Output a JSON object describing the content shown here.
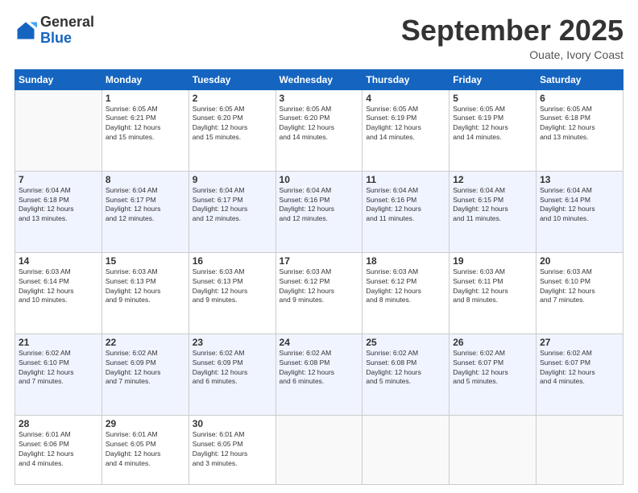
{
  "header": {
    "logo_general": "General",
    "logo_blue": "Blue",
    "month_title": "September 2025",
    "subtitle": "Ouate, Ivory Coast"
  },
  "weekdays": [
    "Sunday",
    "Monday",
    "Tuesday",
    "Wednesday",
    "Thursday",
    "Friday",
    "Saturday"
  ],
  "weeks": [
    [
      {
        "day": "",
        "info": ""
      },
      {
        "day": "1",
        "info": "Sunrise: 6:05 AM\nSunset: 6:21 PM\nDaylight: 12 hours\nand 15 minutes."
      },
      {
        "day": "2",
        "info": "Sunrise: 6:05 AM\nSunset: 6:20 PM\nDaylight: 12 hours\nand 15 minutes."
      },
      {
        "day": "3",
        "info": "Sunrise: 6:05 AM\nSunset: 6:20 PM\nDaylight: 12 hours\nand 14 minutes."
      },
      {
        "day": "4",
        "info": "Sunrise: 6:05 AM\nSunset: 6:19 PM\nDaylight: 12 hours\nand 14 minutes."
      },
      {
        "day": "5",
        "info": "Sunrise: 6:05 AM\nSunset: 6:19 PM\nDaylight: 12 hours\nand 14 minutes."
      },
      {
        "day": "6",
        "info": "Sunrise: 6:05 AM\nSunset: 6:18 PM\nDaylight: 12 hours\nand 13 minutes."
      }
    ],
    [
      {
        "day": "7",
        "info": "Sunrise: 6:04 AM\nSunset: 6:18 PM\nDaylight: 12 hours\nand 13 minutes."
      },
      {
        "day": "8",
        "info": "Sunrise: 6:04 AM\nSunset: 6:17 PM\nDaylight: 12 hours\nand 12 minutes."
      },
      {
        "day": "9",
        "info": "Sunrise: 6:04 AM\nSunset: 6:17 PM\nDaylight: 12 hours\nand 12 minutes."
      },
      {
        "day": "10",
        "info": "Sunrise: 6:04 AM\nSunset: 6:16 PM\nDaylight: 12 hours\nand 12 minutes."
      },
      {
        "day": "11",
        "info": "Sunrise: 6:04 AM\nSunset: 6:16 PM\nDaylight: 12 hours\nand 11 minutes."
      },
      {
        "day": "12",
        "info": "Sunrise: 6:04 AM\nSunset: 6:15 PM\nDaylight: 12 hours\nand 11 minutes."
      },
      {
        "day": "13",
        "info": "Sunrise: 6:04 AM\nSunset: 6:14 PM\nDaylight: 12 hours\nand 10 minutes."
      }
    ],
    [
      {
        "day": "14",
        "info": "Sunrise: 6:03 AM\nSunset: 6:14 PM\nDaylight: 12 hours\nand 10 minutes."
      },
      {
        "day": "15",
        "info": "Sunrise: 6:03 AM\nSunset: 6:13 PM\nDaylight: 12 hours\nand 9 minutes."
      },
      {
        "day": "16",
        "info": "Sunrise: 6:03 AM\nSunset: 6:13 PM\nDaylight: 12 hours\nand 9 minutes."
      },
      {
        "day": "17",
        "info": "Sunrise: 6:03 AM\nSunset: 6:12 PM\nDaylight: 12 hours\nand 9 minutes."
      },
      {
        "day": "18",
        "info": "Sunrise: 6:03 AM\nSunset: 6:12 PM\nDaylight: 12 hours\nand 8 minutes."
      },
      {
        "day": "19",
        "info": "Sunrise: 6:03 AM\nSunset: 6:11 PM\nDaylight: 12 hours\nand 8 minutes."
      },
      {
        "day": "20",
        "info": "Sunrise: 6:03 AM\nSunset: 6:10 PM\nDaylight: 12 hours\nand 7 minutes."
      }
    ],
    [
      {
        "day": "21",
        "info": "Sunrise: 6:02 AM\nSunset: 6:10 PM\nDaylight: 12 hours\nand 7 minutes."
      },
      {
        "day": "22",
        "info": "Sunrise: 6:02 AM\nSunset: 6:09 PM\nDaylight: 12 hours\nand 7 minutes."
      },
      {
        "day": "23",
        "info": "Sunrise: 6:02 AM\nSunset: 6:09 PM\nDaylight: 12 hours\nand 6 minutes."
      },
      {
        "day": "24",
        "info": "Sunrise: 6:02 AM\nSunset: 6:08 PM\nDaylight: 12 hours\nand 6 minutes."
      },
      {
        "day": "25",
        "info": "Sunrise: 6:02 AM\nSunset: 6:08 PM\nDaylight: 12 hours\nand 5 minutes."
      },
      {
        "day": "26",
        "info": "Sunrise: 6:02 AM\nSunset: 6:07 PM\nDaylight: 12 hours\nand 5 minutes."
      },
      {
        "day": "27",
        "info": "Sunrise: 6:02 AM\nSunset: 6:07 PM\nDaylight: 12 hours\nand 4 minutes."
      }
    ],
    [
      {
        "day": "28",
        "info": "Sunrise: 6:01 AM\nSunset: 6:06 PM\nDaylight: 12 hours\nand 4 minutes."
      },
      {
        "day": "29",
        "info": "Sunrise: 6:01 AM\nSunset: 6:05 PM\nDaylight: 12 hours\nand 4 minutes."
      },
      {
        "day": "30",
        "info": "Sunrise: 6:01 AM\nSunset: 6:05 PM\nDaylight: 12 hours\nand 3 minutes."
      },
      {
        "day": "",
        "info": ""
      },
      {
        "day": "",
        "info": ""
      },
      {
        "day": "",
        "info": ""
      },
      {
        "day": "",
        "info": ""
      }
    ]
  ]
}
